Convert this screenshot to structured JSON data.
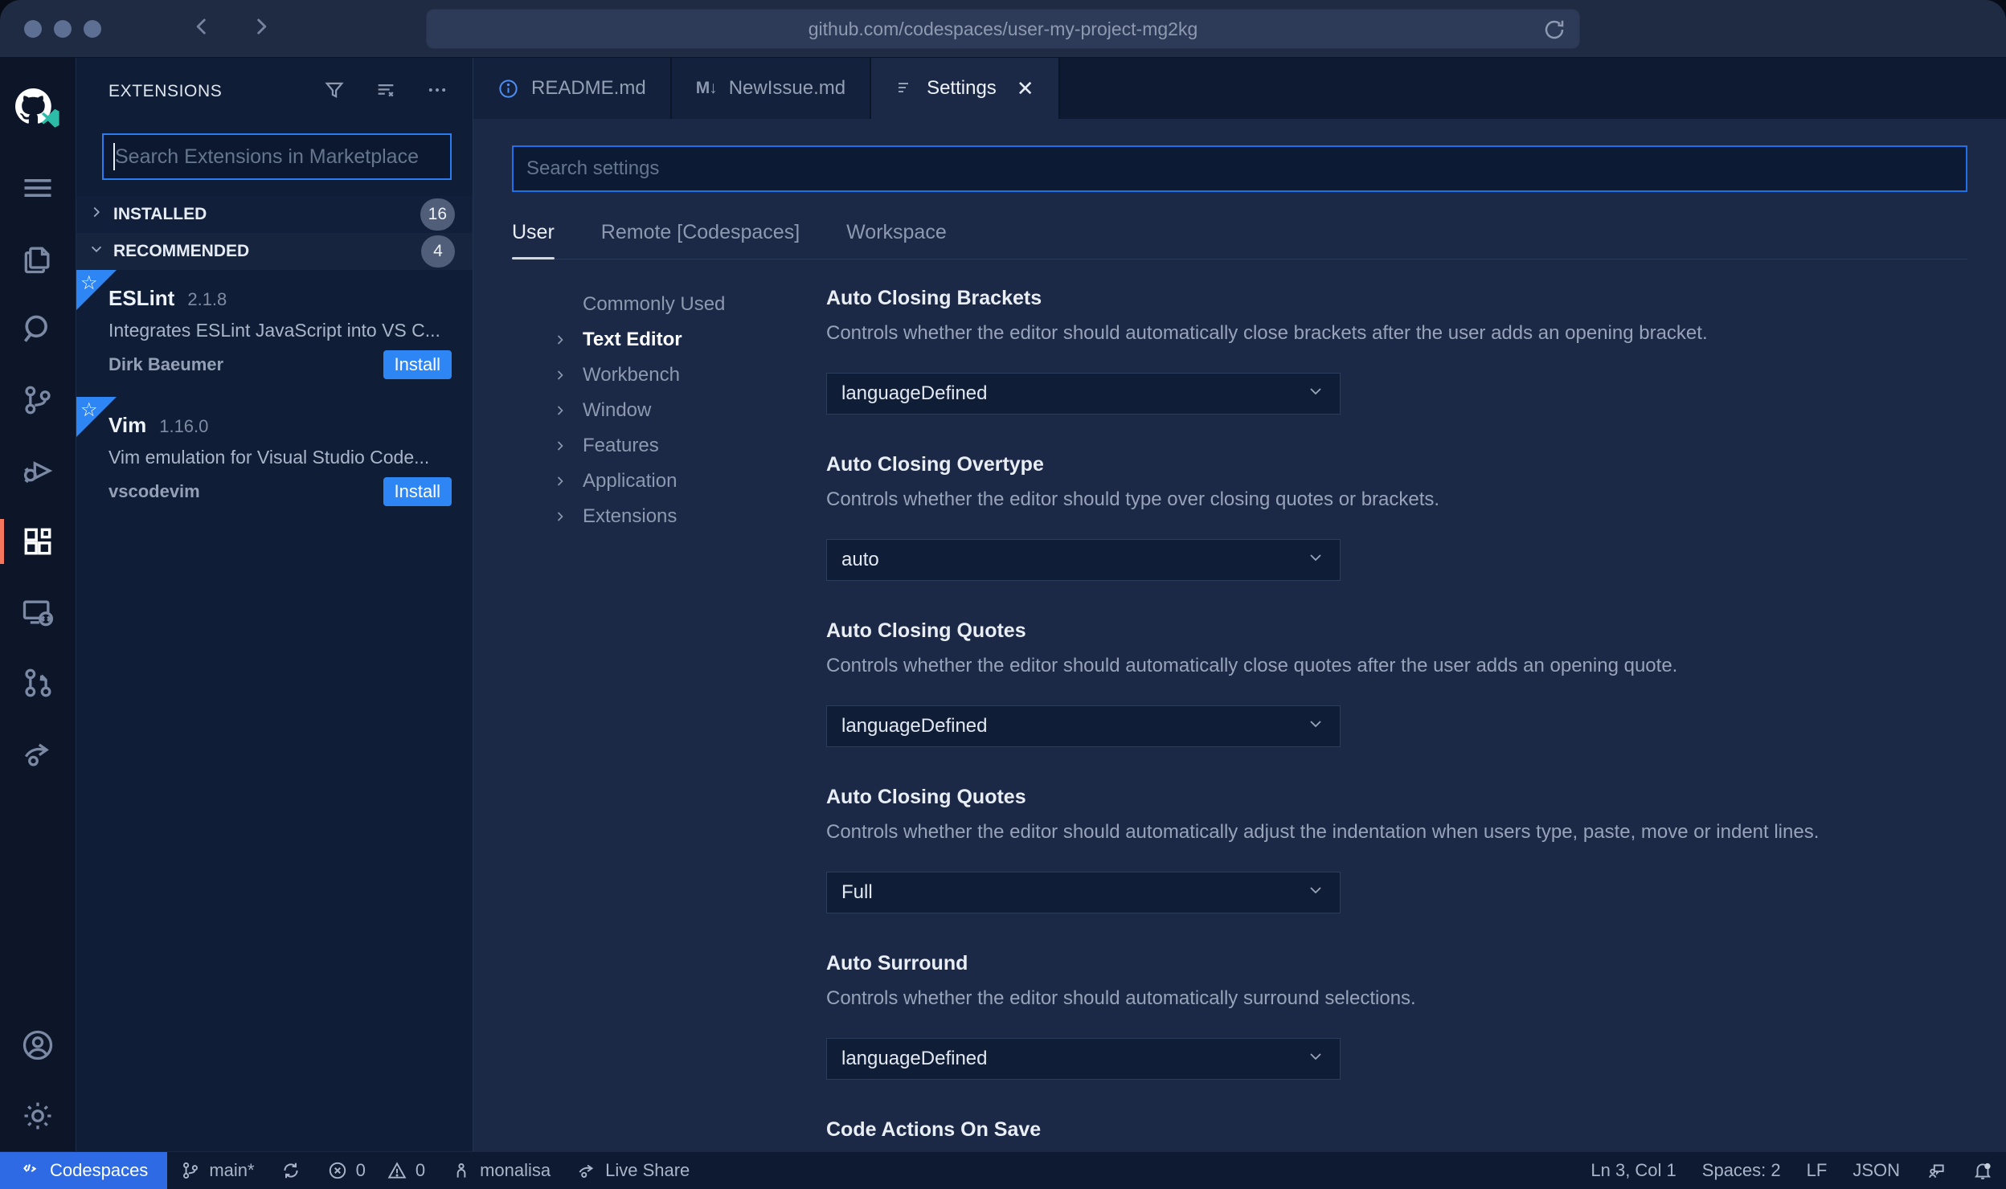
{
  "browser": {
    "url": "github.com/codespaces/user-my-project-mg2kg"
  },
  "activity_bar": {
    "items": [
      "github-logo",
      "menu",
      "explorer",
      "search",
      "source-control",
      "run-debug",
      "extensions",
      "remote-explorer",
      "pull-requests",
      "live-share",
      "account",
      "settings-gear"
    ],
    "active_item": "extensions",
    "active_indicator_color": "#f4765c"
  },
  "sidebar": {
    "title": "EXTENSIONS",
    "search_placeholder": "Search Extensions in Marketplace",
    "sections": [
      {
        "label": "INSTALLED",
        "count": "16"
      },
      {
        "label": "RECOMMENDED",
        "count": "4"
      }
    ],
    "extensions": [
      {
        "name": "ESLint",
        "version": "2.1.8",
        "description": "Integrates ESLint JavaScript into VS C...",
        "author": "Dirk Baeumer",
        "action": "Install"
      },
      {
        "name": "Vim",
        "version": "1.16.0",
        "description": "Vim emulation for Visual Studio Code...",
        "author": "vscodevim",
        "action": "Install"
      }
    ]
  },
  "tabs": [
    {
      "label": "README.md",
      "icon": "info-icon"
    },
    {
      "label": "NewIssue.md",
      "icon": "markdown-icon",
      "icon_text": "M↓"
    },
    {
      "label": "Settings",
      "icon": "settings-editor-icon",
      "close": "✕",
      "active": true
    }
  ],
  "settings": {
    "search_placeholder": "Search settings",
    "scopes": {
      "user": "User",
      "remote": "Remote [Codespaces]",
      "workspace": "Workspace"
    },
    "active_scope": "User",
    "tree": [
      "Commonly Used",
      "Text Editor",
      "Workbench",
      "Window",
      "Features",
      "Application",
      "Extensions"
    ],
    "active_tree_item": "Text Editor",
    "items": [
      {
        "title": "Auto Closing Brackets",
        "description": "Controls whether the editor should automatically close brackets after the user adds an opening bracket.",
        "value": "languageDefined"
      },
      {
        "title": "Auto Closing Overtype",
        "description": "Controls whether the editor should type over closing quotes or brackets.",
        "value": "auto"
      },
      {
        "title": "Auto Closing Quotes",
        "description": "Controls whether the editor should automatically close quotes after the user adds an opening quote.",
        "value": "languageDefined"
      },
      {
        "title": "Auto Closing Quotes",
        "description": "Controls whether the editor should automatically adjust the indentation when users type, paste, move or indent lines.",
        "value": "Full"
      },
      {
        "title": "Auto Surround",
        "description": "Controls whether the editor should automatically surround selections.",
        "value": "languageDefined"
      },
      {
        "title": "Code Actions On Save",
        "description": "",
        "value": ""
      }
    ]
  },
  "status_bar": {
    "codespaces": "Codespaces",
    "branch": "main*",
    "errors": "0",
    "warnings": "0",
    "user": "monalisa",
    "live_share": "Live Share",
    "cursor": "Ln 3, Col 1",
    "indent": "Spaces: 2",
    "eol": "LF",
    "language": "JSON"
  },
  "colors": {
    "accent_blue": "#2e86f5",
    "focus_border": "#1f6feb",
    "active_indicator": "#f4765c",
    "statusbar_remote_bg": "#2d6ae3",
    "editor_bg": "#1b2947",
    "sidebar_bg": "#101d36",
    "activitybar_bg": "#0c1628",
    "titlebar_bg": "#1f2a43"
  }
}
